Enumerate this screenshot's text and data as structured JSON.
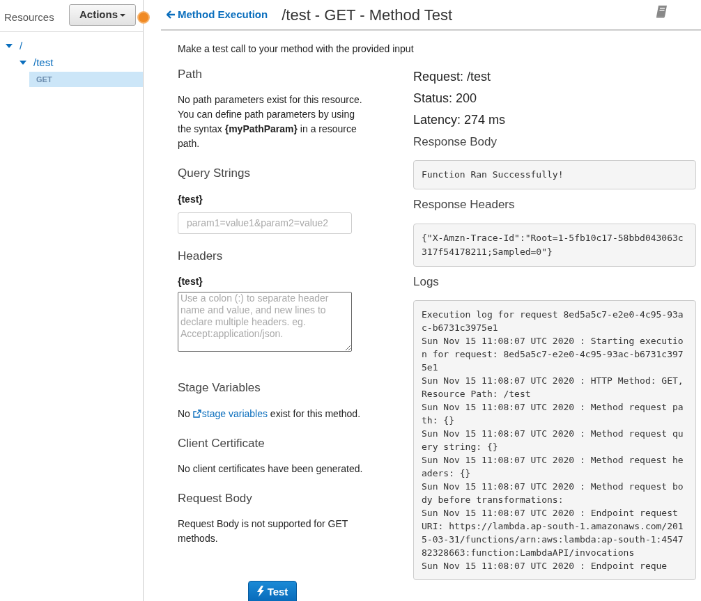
{
  "sidebar": {
    "title": "Resources",
    "actions_button": "Actions",
    "tree": [
      {
        "kind": "resource",
        "label": "/",
        "expanded": true,
        "selected": false,
        "children": [
          {
            "kind": "resource",
            "label": "/test",
            "expanded": true,
            "selected": false,
            "children": [
              {
                "kind": "method",
                "label": "GET",
                "selected": true
              }
            ]
          }
        ]
      }
    ]
  },
  "header": {
    "back_link": "Method Execution",
    "title": "/test - GET - Method Test"
  },
  "intro": "Make a test call to your method with the provided input",
  "left": {
    "sections": [
      {
        "kind": "text",
        "heading": "Path",
        "text": "No path parameters exist for this resource. You can define path parameters by using the syntax **{myPathParam}** in a resource path."
      },
      {
        "kind": "input",
        "heading": "Query Strings",
        "label": "{test}",
        "placeholder": "param1=value1&param2=value2"
      },
      {
        "kind": "textarea",
        "heading": "Headers",
        "label": "{test}",
        "placeholder": "Use a colon (:) to separate header name and value, and new lines to declare multiple headers. eg. Accept:application/json."
      },
      {
        "kind": "link",
        "heading": "Stage Variables",
        "before": "No",
        "link": "stage variables",
        "after": "exist for this method."
      },
      {
        "kind": "text",
        "heading": "Client Certificate",
        "text": "No client certificates have been generated."
      },
      {
        "kind": "text",
        "heading": "Request Body",
        "text": "Request Body is not supported for GET methods."
      }
    ],
    "test_button": "Test"
  },
  "right": {
    "request": "Request: /test",
    "status": "Status: 200",
    "latency": "Latency: 274 ms",
    "response_body_heading": "Response Body",
    "response_body": "Function Ran Successfully!",
    "response_headers_heading": "Response Headers",
    "response_headers": "{\"X-Amzn-Trace-Id\":\"Root=1-5fb10c17-58bbd043063c317f54178211;Sampled=0\"}",
    "logs_heading": "Logs",
    "logs": [
      "Execution log for request 8ed5a5c7-e2e0-4c95-93ac-b6731c3975e1",
      "Sun Nov 15 11:08:07 UTC 2020 : Starting execution for request: 8ed5a5c7-e2e0-4c95-93ac-b6731c3975e1",
      "Sun Nov 15 11:08:07 UTC 2020 : HTTP Method: GET, Resource Path: /test",
      "Sun Nov 15 11:08:07 UTC 2020 : Method request path: {}",
      "Sun Nov 15 11:08:07 UTC 2020 : Method request query string: {}",
      "Sun Nov 15 11:08:07 UTC 2020 : Method request headers: {}",
      "Sun Nov 15 11:08:07 UTC 2020 : Method request body before transformations:",
      "Sun Nov 15 11:08:07 UTC 2020 : Endpoint request URI: https://lambda.ap-south-1.amazonaws.com/2015-03-31/functions/arn:aws:lambda:ap-south-1:454782328663:function:LambdaAPI/invocations",
      "Sun Nov 15 11:08:07 UTC 2020 : Endpoint reque"
    ]
  }
}
